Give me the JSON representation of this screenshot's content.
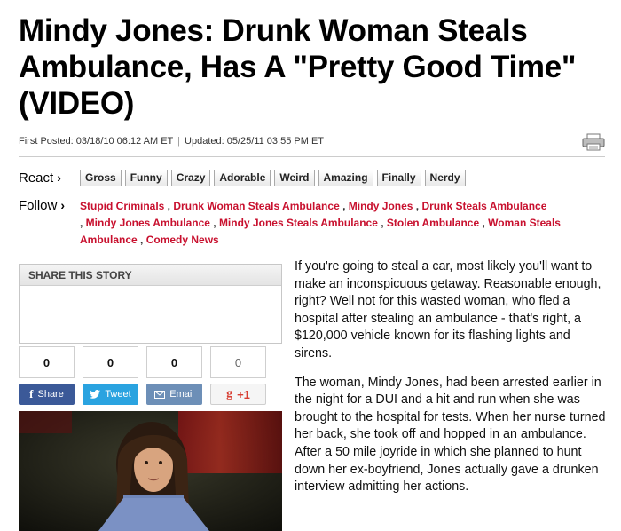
{
  "headline": "Mindy Jones: Drunk Woman Steals Ambulance, Has A \"Pretty Good Time\" (VIDEO)",
  "meta": {
    "first_posted": "First Posted: 03/18/10 06:12 AM ET",
    "separator": "|",
    "updated": "Updated: 05/25/11 03:55 PM ET"
  },
  "react": {
    "label": "React",
    "buttons": [
      "Gross",
      "Funny",
      "Crazy",
      "Adorable",
      "Weird",
      "Amazing",
      "Finally",
      "Nerdy"
    ]
  },
  "follow": {
    "label": "Follow",
    "tags": [
      "Stupid Criminals",
      "Drunk Woman Steals Ambulance",
      "Mindy Jones",
      "Drunk Steals Ambulance",
      "Mindy Jones Ambulance",
      "Mindy Jones Steals Ambulance",
      "Stolen Ambulance",
      "Woman Steals Ambulance",
      "Comedy News"
    ]
  },
  "share": {
    "title": "SHARE THIS STORY",
    "counts": [
      "0",
      "0",
      "0",
      "0"
    ],
    "facebook_label": "Share",
    "twitter_label": "Tweet",
    "email_label": "Email",
    "gplus_label": "+1"
  },
  "article": {
    "paragraphs": [
      "If you're going to steal a car, most likely you'll want to make an inconspicuous getaway. Reasonable enough, right? Well not for this wasted woman, who fled a hospital after stealing an ambulance - that's right, a $120,000 vehicle known for its flashing lights and sirens.",
      "The woman, Mindy Jones, had been arrested earlier in the night for a DUI and a hit and run when she was brought to the hospital for tests. When her nurse turned her back, she took off and hopped in an ambulance. After a 50 mile joyride in which she planned to hunt down her ex-boyfriend, Jones actually gave a drunken interview admitting her actions."
    ]
  },
  "colors": {
    "tag_red": "#c8102e",
    "facebook": "#3b5998",
    "twitter": "#2aa3e0",
    "email": "#6d8fb7"
  }
}
